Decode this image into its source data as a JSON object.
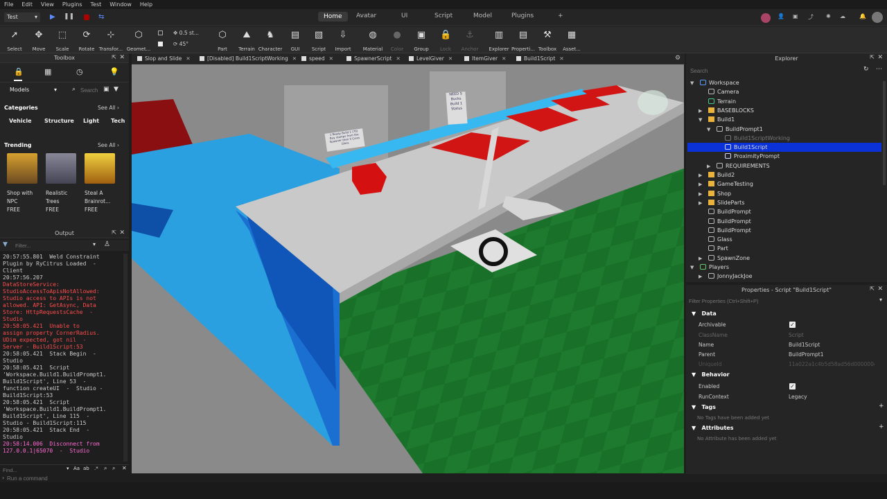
{
  "menu": [
    "File",
    "Edit",
    "View",
    "Plugins",
    "Test",
    "Window",
    "Help"
  ],
  "mode": "Test",
  "top_tabs": [
    "Home",
    "Avatar",
    "UI",
    "Script",
    "Model",
    "Plugins",
    "+"
  ],
  "ribbon": {
    "tools": [
      "Select",
      "Move",
      "Scale",
      "Rotate",
      "Transfor...",
      "Geomet...",
      "Part",
      "Terrain",
      "Character",
      "GUI",
      "Script",
      "Import",
      "Material",
      "Color",
      "Group",
      "Lock",
      "Anchor",
      "Explorer",
      "Properti...",
      "Toolbox",
      "Asset..."
    ],
    "move_snap": "0.5 st...",
    "rotate_snap": "45°"
  },
  "toolbox": {
    "title": "Toolbox",
    "category_select": "Models",
    "search_placeholder": "Search",
    "categories_title": "Categories",
    "see_all": "See All",
    "categories": [
      "Vehicle",
      "Structure",
      "Light",
      "Tech"
    ],
    "trending_title": "Trending",
    "items": [
      {
        "name": "Shop with NPC",
        "price": "FREE"
      },
      {
        "name": "Realistic Trees",
        "price": "FREE"
      },
      {
        "name": "Steal A Brainrot...",
        "price": "FREE"
      }
    ]
  },
  "output": {
    "title": "Output",
    "filter_placeholder": "Filter...",
    "lines": [
      {
        "text": "20:57:55.801  Weld Constraint\nPlugin by RyCitrus Loaded  -\nClient",
        "color": "normal"
      },
      {
        "text": "20:57:56.207",
        "color": "normal"
      },
      {
        "text": "DataStoreService:\nStudioAccessToApisNotAllowed:\nStudio access to APIs is not\nallowed. API: GetAsync, Data\nStore: HttpRequestsCache  -\nStudio",
        "color": "red"
      },
      {
        "text": "20:58:05.421  Unable to\nassign property CornerRadius.\nUDim expected, got nil  -\nServer - Build1Script:53",
        "color": "red"
      },
      {
        "text": "20:58:05.421  Stack Begin  -\nStudio",
        "color": "normal"
      },
      {
        "text": "20:58:05.421  Script\n'Workspace.Build1.BuildPrompt1.\nBuild1Script', Line 53  -\nfunction createUI  -  Studio -\nBuild1Script:53",
        "color": "normal"
      },
      {
        "text": "20:58:05.421  Script\n'Workspace.Build1.BuildPrompt1.\nBuild1Script', Line 115  -\nStudio - Build1Script:115",
        "color": "normal"
      },
      {
        "text": "20:58:05.421  Stack End  -\nStudio",
        "color": "normal"
      },
      {
        "text": "20:58:14.006  Disconnect from\n127.0.0.1|65070  -  Studio",
        "color": "pink"
      }
    ],
    "find_placeholder": "Find..."
  },
  "doc_tabs": [
    "Slop and Slide",
    "[Disabled] Build1ScriptWorking",
    "speed",
    "SpawnerScript",
    "LevelGiver",
    "ItemGiver",
    "Build1Script"
  ],
  "viewport": {
    "signs": [
      "1 Ready Build 1 (70)\nBuy stamps from the\nSpawner then 5 Coins\nGlass",
      "NEED 5\nBucks\nBuild 1\nStatus"
    ]
  },
  "explorer": {
    "title": "Explorer",
    "search_placeholder": "Search",
    "tree": [
      {
        "label": "Workspace",
        "depth": 0,
        "icon": "workspace",
        "arrow": "▼"
      },
      {
        "label": "Camera",
        "depth": 1,
        "icon": "camera",
        "arrow": ""
      },
      {
        "label": "Terrain",
        "depth": 1,
        "icon": "terrain",
        "arrow": ""
      },
      {
        "label": "BASEBLOCKS",
        "depth": 1,
        "icon": "folder",
        "arrow": "▶"
      },
      {
        "label": "Build1",
        "depth": 1,
        "icon": "folder",
        "arrow": "▼"
      },
      {
        "label": "BuildPrompt1",
        "depth": 2,
        "icon": "model",
        "arrow": "▼"
      },
      {
        "label": "Build1ScriptWorking",
        "depth": 3,
        "icon": "script-disabled",
        "arrow": ""
      },
      {
        "label": "Build1Script",
        "depth": 3,
        "icon": "script",
        "arrow": "",
        "selected": true
      },
      {
        "label": "ProximityPrompt",
        "depth": 3,
        "icon": "prompt",
        "arrow": ""
      },
      {
        "label": "REQUIREMENTS",
        "depth": 2,
        "icon": "model",
        "arrow": "▶"
      },
      {
        "label": "Build2",
        "depth": 1,
        "icon": "folder",
        "arrow": "▶"
      },
      {
        "label": "GameTesting",
        "depth": 1,
        "icon": "folder",
        "arrow": "▶"
      },
      {
        "label": "Shop",
        "depth": 1,
        "icon": "folder",
        "arrow": "▶"
      },
      {
        "label": "SlideParts",
        "depth": 1,
        "icon": "folder",
        "arrow": "▶"
      },
      {
        "label": "BuildPrompt",
        "depth": 1,
        "icon": "model",
        "arrow": ""
      },
      {
        "label": "BuildPrompt",
        "depth": 1,
        "icon": "model",
        "arrow": ""
      },
      {
        "label": "BuildPrompt",
        "depth": 1,
        "icon": "model",
        "arrow": ""
      },
      {
        "label": "Glass",
        "depth": 1,
        "icon": "model",
        "arrow": ""
      },
      {
        "label": "Part",
        "depth": 1,
        "icon": "model",
        "arrow": ""
      },
      {
        "label": "SpawnZone",
        "depth": 1,
        "icon": "model",
        "arrow": "▶"
      },
      {
        "label": "Players",
        "depth": 0,
        "icon": "players",
        "arrow": "▼"
      },
      {
        "label": "JonnyJackJoe",
        "depth": 1,
        "icon": "player",
        "arrow": "▶"
      }
    ]
  },
  "properties": {
    "title": "Properties - Script \"Build1Script\"",
    "filter_placeholder": "Filter Properties (Ctrl+Shift+P)",
    "sections": {
      "data": "Data",
      "behavior": "Behavior",
      "tags": "Tags",
      "attributes": "Attributes"
    },
    "rows": {
      "archivable": {
        "name": "Archivable"
      },
      "classname": {
        "name": "ClassName",
        "value": "Script"
      },
      "name": {
        "name": "Name",
        "value": "Build1Script"
      },
      "parent": {
        "name": "Parent",
        "value": "BuildPrompt1"
      },
      "uniqueid": {
        "name": "UniqueId",
        "value": "11a022a1c4b5d58ad56d000000cef"
      },
      "enabled": {
        "name": "Enabled"
      },
      "runcontext": {
        "name": "RunContext",
        "value": "Legacy"
      }
    },
    "no_tags": "No Tags have been added yet",
    "no_attributes": "No Attribute has been added yet"
  },
  "command_placeholder": "Run a command",
  "colors": {
    "accent": "#0a32d8",
    "error": "#ff4d4d",
    "disconnect": "#ff6ad5"
  }
}
